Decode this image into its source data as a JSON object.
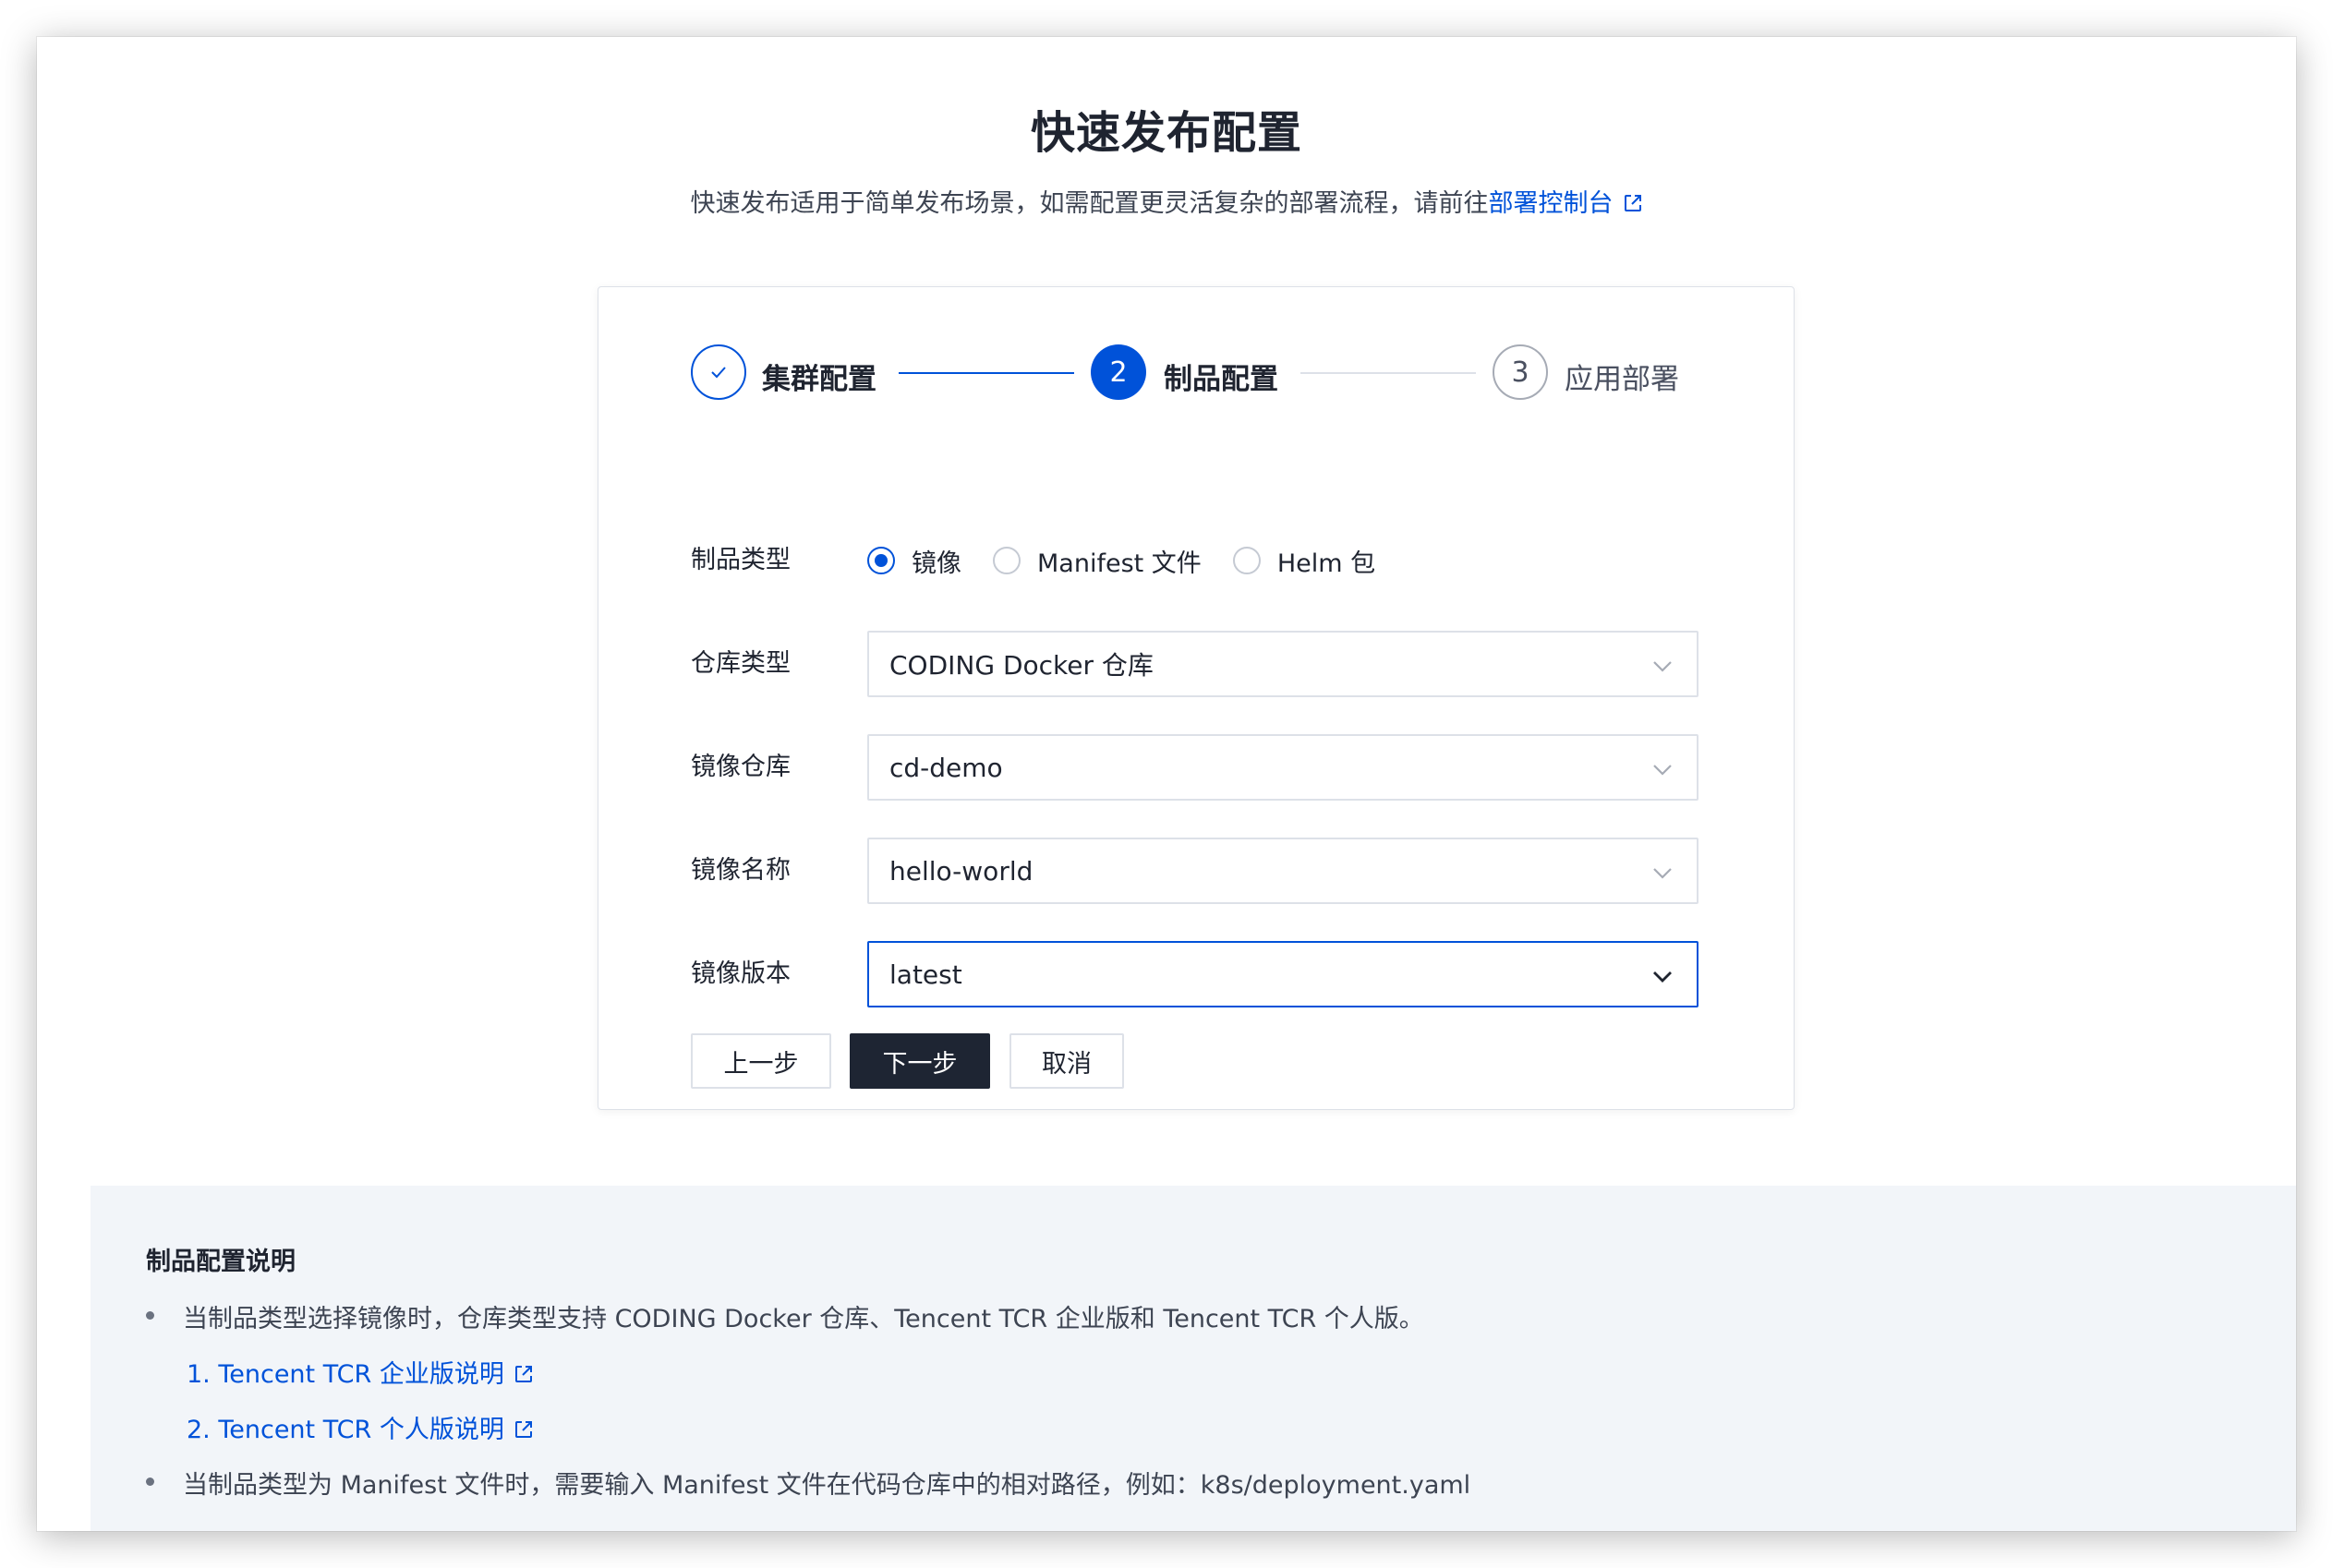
{
  "header": {
    "title": "快速发布配置",
    "subtitle_prefix": "快速发布适用于简单发布场景，如需配置更灵活复杂的部署流程，请前往",
    "subtitle_link": "部署控制台"
  },
  "stepper": {
    "steps": [
      {
        "number": "1",
        "label": "集群配置",
        "state": "completed"
      },
      {
        "number": "2",
        "label": "制品配置",
        "state": "active"
      },
      {
        "number": "3",
        "label": "应用部署",
        "state": "pending"
      }
    ]
  },
  "form": {
    "artifact_type": {
      "label": "制品类型",
      "options": [
        "镜像",
        "Manifest 文件",
        "Helm 包"
      ],
      "selected": "镜像"
    },
    "repo_type": {
      "label": "仓库类型",
      "value": "CODING Docker 仓库"
    },
    "image_repo": {
      "label": "镜像仓库",
      "value": "cd-demo"
    },
    "image_name": {
      "label": "镜像名称",
      "value": "hello-world"
    },
    "image_version": {
      "label": "镜像版本",
      "value": "latest"
    }
  },
  "buttons": {
    "prev": "上一步",
    "next": "下一步",
    "cancel": "取消"
  },
  "info": {
    "title": "制品配置说明",
    "bullet1": "当制品类型选择镜像时，仓库类型支持 CODING Docker 仓库、Tencent TCR 企业版和 Tencent TCR 个人版。",
    "link1": "1. Tencent TCR 企业版说明",
    "link2": "2. Tencent TCR 个人版说明",
    "bullet2": "当制品类型为 Manifest 文件时，需要输入 Manifest 文件在代码仓库中的相对路径，例如：k8s/deployment.yaml"
  },
  "colors": {
    "primary": "#0052d9",
    "dark_button": "#1e2533",
    "info_bg": "#f2f5f9"
  },
  "icons": [
    "external-link-icon",
    "check-icon",
    "chevron-down-icon"
  ]
}
